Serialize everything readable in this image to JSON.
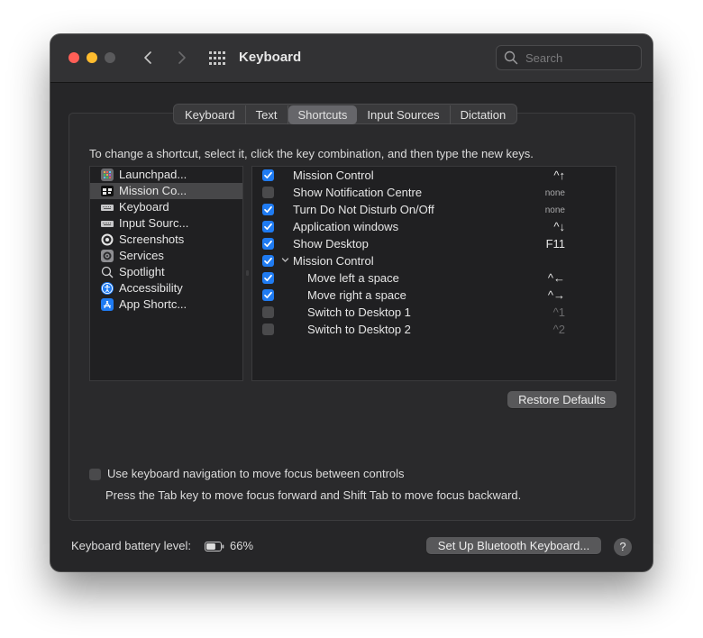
{
  "window": {
    "title": "Keyboard",
    "search": {
      "placeholder": "Search",
      "value": ""
    }
  },
  "tabs": [
    {
      "label": "Keyboard",
      "active": false
    },
    {
      "label": "Text",
      "active": false
    },
    {
      "label": "Shortcuts",
      "active": true
    },
    {
      "label": "Input Sources",
      "active": false
    },
    {
      "label": "Dictation",
      "active": false
    }
  ],
  "instruction": "To change a shortcut, select it, click the key combination, and then type the new keys.",
  "categories": [
    {
      "label": "Launchpad...",
      "icon": "launchpad-icon",
      "selected": false
    },
    {
      "label": "Mission Co...",
      "icon": "mission-control-icon",
      "selected": true
    },
    {
      "label": "Keyboard",
      "icon": "keyboard-icon",
      "selected": false
    },
    {
      "label": "Input Sourc...",
      "icon": "input-sources-icon",
      "selected": false
    },
    {
      "label": "Screenshots",
      "icon": "screenshots-icon",
      "selected": false
    },
    {
      "label": "Services",
      "icon": "services-gear-icon",
      "selected": false
    },
    {
      "label": "Spotlight",
      "icon": "spotlight-icon",
      "selected": false
    },
    {
      "label": "Accessibility",
      "icon": "accessibility-icon",
      "selected": false
    },
    {
      "label": "App Shortc...",
      "icon": "app-store-icon",
      "selected": false
    }
  ],
  "shortcuts": [
    {
      "label": "Mission Control",
      "key": "^↑",
      "checked": true,
      "indent": 0,
      "group": false,
      "keyStyle": "normal"
    },
    {
      "label": "Show Notification Centre",
      "key": "none",
      "checked": false,
      "indent": 0,
      "group": false,
      "keyStyle": "none"
    },
    {
      "label": "Turn Do Not Disturb On/Off",
      "key": "none",
      "checked": true,
      "indent": 0,
      "group": false,
      "keyStyle": "none"
    },
    {
      "label": "Application windows",
      "key": "^↓",
      "checked": true,
      "indent": 0,
      "group": false,
      "keyStyle": "normal"
    },
    {
      "label": "Show Desktop",
      "key": "F11",
      "checked": true,
      "indent": 0,
      "group": false,
      "keyStyle": "normal"
    },
    {
      "label": "Mission Control",
      "key": "",
      "checked": true,
      "indent": 0,
      "group": true,
      "keyStyle": "normal"
    },
    {
      "label": "Move left a space",
      "key": "^←",
      "checked": true,
      "indent": 1,
      "group": false,
      "keyStyle": "normal"
    },
    {
      "label": "Move right a space",
      "key": "^→",
      "checked": true,
      "indent": 1,
      "group": false,
      "keyStyle": "normal"
    },
    {
      "label": "Switch to Desktop 1",
      "key": "^1",
      "checked": false,
      "indent": 1,
      "group": false,
      "keyStyle": "dim"
    },
    {
      "label": "Switch to Desktop 2",
      "key": "^2",
      "checked": false,
      "indent": 1,
      "group": false,
      "keyStyle": "dim"
    }
  ],
  "restore_defaults_label": "Restore Defaults",
  "keyboard_navigation": {
    "label": "Use keyboard navigation to move focus between controls",
    "checked": false,
    "help_text": "Press the Tab key to move focus forward and Shift Tab to move focus backward."
  },
  "battery": {
    "label": "Keyboard battery level:",
    "value": "66%",
    "level_fraction": 0.66
  },
  "setup_bluetooth_label": "Set Up Bluetooth Keyboard...",
  "help_label": "?",
  "colors": {
    "accent": "#1f7bf2",
    "window_bg": "#262628",
    "titlebar": "#323234"
  }
}
